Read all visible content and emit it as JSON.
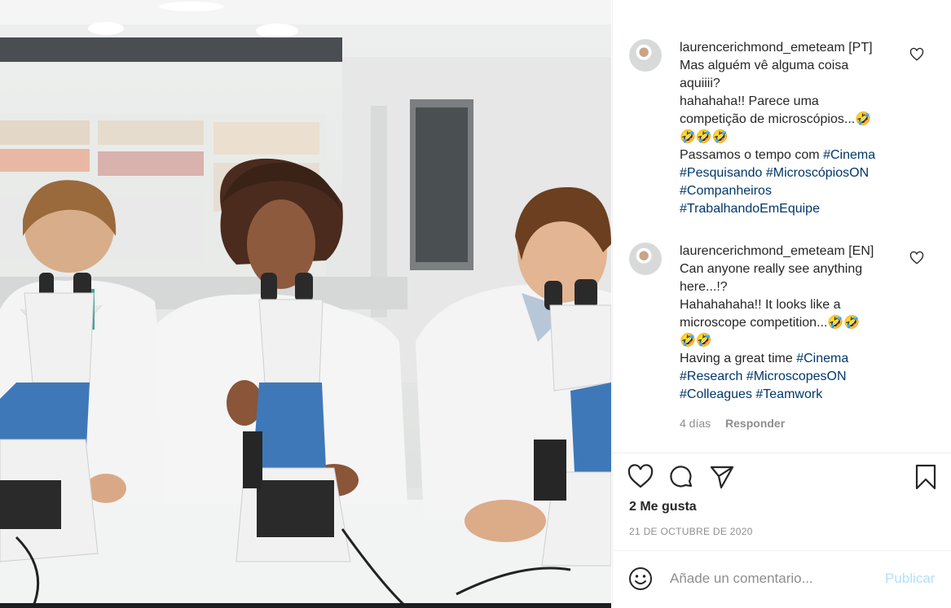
{
  "post": {
    "comments": [
      {
        "username": "laurencerichmond_emeteam",
        "lang_tag": "[PT]",
        "lines": [
          "Mas alguém vê alguma coisa",
          "aquiiii?",
          "hahahaha!! Parece uma",
          "competição de microscópios...🤣",
          "🤣🤣🤣"
        ],
        "hashtag_intro": "Passamos o tempo com",
        "hashtags": [
          "#Cinema",
          "#Pesquisando",
          "#MicroscópiosON",
          "#Companheiros",
          "#TrabalhandoEmEquipe"
        ]
      },
      {
        "username": "laurencerichmond_emeteam",
        "lang_tag": "[EN]",
        "lines": [
          "Can anyone really see anything",
          "here...!?",
          "Hahahahaha!! It looks like a",
          "microscope competition...🤣🤣",
          "🤣🤣"
        ],
        "hashtag_intro": "Having a great time",
        "hashtags": [
          "#Cinema",
          "#Research",
          "#MicroscopesON",
          "#Colleagues",
          "#Teamwork"
        ],
        "age": "4 días",
        "reply_label": "Responder"
      }
    ],
    "likes_text": "2 Me gusta",
    "date_text": "21 DE OCTUBRE DE 2020",
    "comment_placeholder": "Añade un comentario...",
    "post_button": "Publicar"
  },
  "icons": {
    "like": "heart-icon",
    "comment": "comment-bubble-icon",
    "share": "paper-plane-icon",
    "save": "bookmark-icon",
    "emoji": "smiley-icon",
    "comment_like": "heart-outline-icon"
  },
  "colors": {
    "hashtag": "#00376b",
    "text": "#262626",
    "muted": "#8e8e8e",
    "publish_disabled": "#b2dffc",
    "microscope_blue": "#3f78b8"
  }
}
